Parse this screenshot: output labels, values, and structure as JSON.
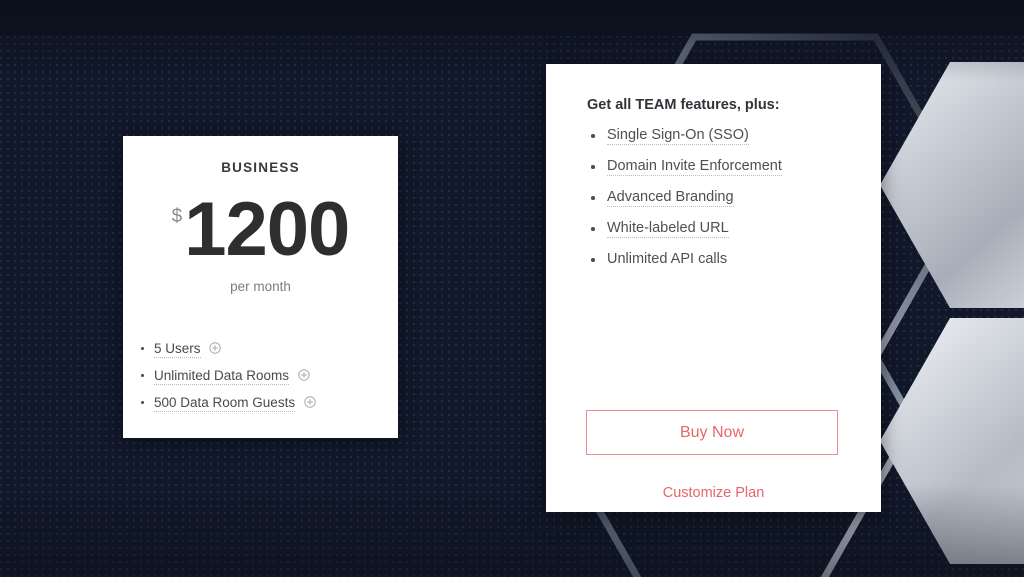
{
  "theme": {
    "background_color": "#101726",
    "card_color": "#ffffff",
    "accent_color": "#e8656a",
    "hex_silver": "#c8cdd6",
    "dot_color": "#222d45"
  },
  "business_card": {
    "plan_name": "BUSINESS",
    "currency_symbol": "$",
    "price": "1200",
    "period": "per month",
    "specs": [
      {
        "label": "5 Users",
        "icon": "plus-circle-icon",
        "underlined": true
      },
      {
        "label": "Unlimited Data Rooms",
        "icon": "plus-circle-icon",
        "underlined": true
      },
      {
        "label": "500 Data Room Guests",
        "icon": "plus-circle-icon",
        "underlined": true
      }
    ]
  },
  "features_panel": {
    "title": "Get all TEAM features, plus:",
    "features": [
      {
        "label": "Single Sign-On (SSO)",
        "underlined": true
      },
      {
        "label": "Domain Invite Enforcement",
        "underlined": true
      },
      {
        "label": "Advanced Branding",
        "underlined": true
      },
      {
        "label": "White-labeled URL",
        "underlined": true
      },
      {
        "label": "Unlimited API calls",
        "underlined": false
      }
    ],
    "buy_now_label": "Buy Now",
    "customize_plan_label": "Customize Plan"
  }
}
